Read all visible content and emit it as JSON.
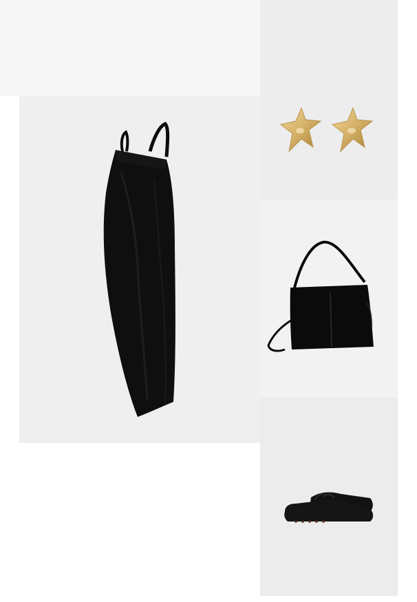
{
  "board": {
    "background": "#ffffff",
    "items": [
      {
        "name": "dress",
        "icon": "black-slip-dress-image",
        "color": "#0d0d0d"
      },
      {
        "name": "earrings",
        "icon": "gold-star-earrings-image",
        "color": "#d4b067"
      },
      {
        "name": "bag",
        "icon": "black-suede-shoulder-bag-image",
        "color": "#0b0b0b"
      },
      {
        "name": "shoes",
        "icon": "black-leather-loafers-image",
        "color": "#151515"
      }
    ]
  }
}
